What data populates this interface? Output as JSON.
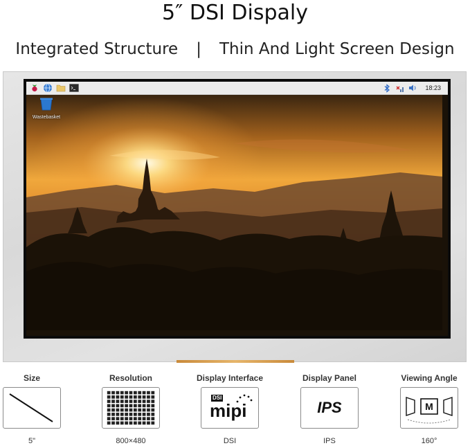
{
  "header": {
    "title": "5″ DSI Dispaly",
    "subtitle_left": "Integrated Structure",
    "subtitle_sep": "|",
    "subtitle_right": "Thin And Light Screen Design"
  },
  "taskbar": {
    "left_icons": [
      "raspberry-icon",
      "globe-icon",
      "folder-icon",
      "terminal-icon"
    ],
    "right_icons": [
      "bluetooth-icon",
      "network-disconnected-icon",
      "volume-icon"
    ],
    "clock": "18:23"
  },
  "desktop": {
    "trash_label": "Wastebasket"
  },
  "specs": [
    {
      "title": "Size",
      "value": "5\"",
      "icon": "diagonal-size-icon"
    },
    {
      "title": "Resolution",
      "value": "800×480",
      "icon": "pixel-grid-icon"
    },
    {
      "title": "Display Interface",
      "value": "DSI",
      "icon": "mipi-dsi-logo",
      "logo_top": "DSI",
      "logo_main": "mipi"
    },
    {
      "title": "Display Panel",
      "value": "IPS",
      "icon": "ips-icon",
      "logo_main": "IPS"
    },
    {
      "title": "Viewing Angle",
      "value": "160°",
      "icon": "viewing-angle-icon",
      "logo_main": "M"
    }
  ],
  "colors": {
    "accent_strip": "#d49a4a",
    "sky_top": "#e7a33a",
    "sun": "#fff4c8"
  }
}
